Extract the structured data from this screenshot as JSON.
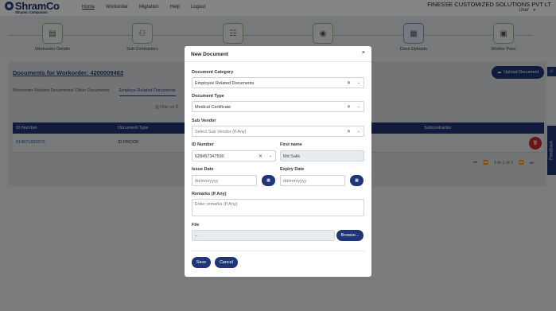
{
  "header": {
    "logo_text": "ShramCo",
    "logo_sub": "Shramic Companion",
    "nav": [
      "Home",
      "Workorder",
      "Migration",
      "Help",
      "Logout"
    ],
    "company": "FINESSE CUSTOMIZED SOLUTIONS PVT LT",
    "user": "User"
  },
  "tiles": [
    {
      "label": "Workorder Details",
      "icon": "document-icon"
    },
    {
      "label": "Sub Contractors",
      "icon": "org-icon"
    },
    {
      "label": "",
      "icon": "id-icon"
    },
    {
      "label": "",
      "icon": "globe-icon"
    },
    {
      "label": "Docs Uploads",
      "icon": "docs-icon"
    },
    {
      "label": "Worker Pass",
      "icon": "pass-icon"
    }
  ],
  "page": {
    "title": "Documents for Workorder: 4200009463",
    "upload_button": "Upload Document",
    "tabs": [
      "Workorder Related Documents/ Other Documents",
      "Employe Related Documents"
    ],
    "filter_placeholder": "Filter on D",
    "columns": [
      "ID Number",
      "Document Type",
      "Subcontractor"
    ],
    "rows": [
      {
        "id": "814871662076",
        "type": "ID PROOF"
      }
    ],
    "pager_text": "1 to 1 of 1",
    "feedback": "Feedback"
  },
  "modal": {
    "title": "New Document",
    "close": "×",
    "category_label": "Document Category",
    "category_value": "Employee Related Documents",
    "type_label": "Document Type",
    "type_value": "Medical Certificate",
    "vendor_label": "Sub Vendor",
    "vendor_placeholder": "Select Sub Vendor (If Any)",
    "id_label": "ID Number",
    "id_value": "628457347590",
    "name_label": "First name",
    "name_value": "Md Salik",
    "issue_label": "Issue Date",
    "issue_placeholder": "dd/mm/yyyy",
    "expiry_label": "Expiry Date",
    "expiry_placeholder": "dd/mm/yyyy",
    "remarks_label": "Remarks (If Any)",
    "remarks_placeholder": "Enter remarks (If Any)",
    "file_label": "File",
    "file_value": "--",
    "browse": "Browse...",
    "save": "Save",
    "cancel": "Cancel"
  },
  "colors": {
    "primary": "#1f3577",
    "danger": "#c92a2a",
    "tile_green": "#8fbf8a"
  }
}
